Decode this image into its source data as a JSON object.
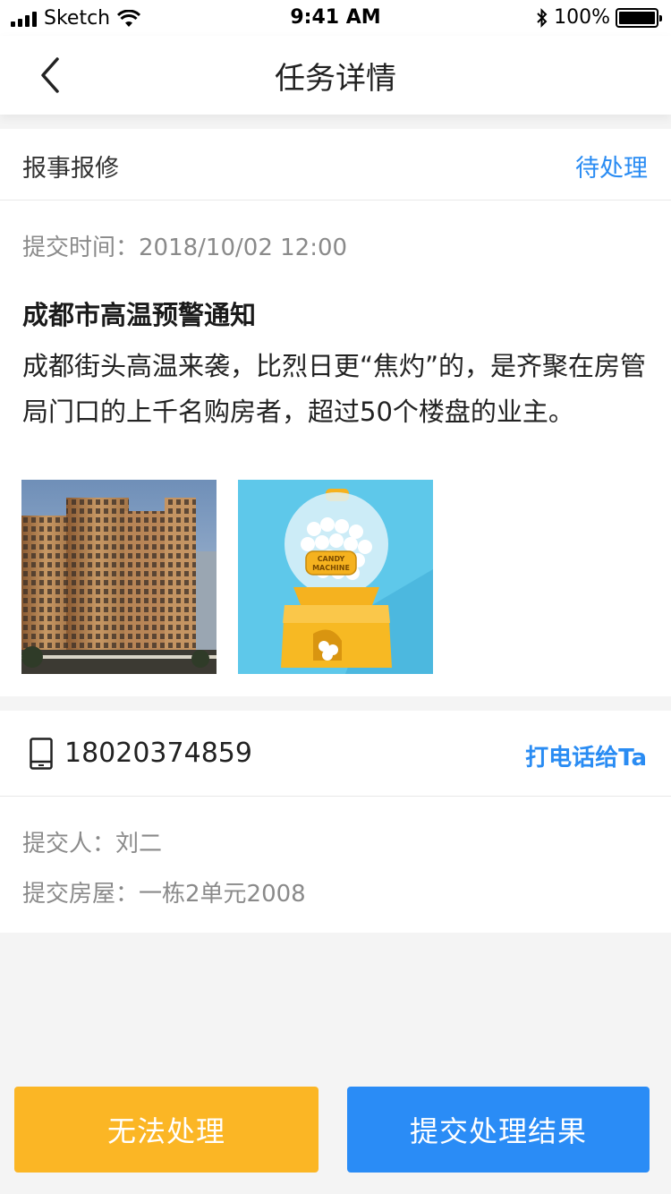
{
  "status_bar": {
    "carrier": "Sketch",
    "time": "9:41 AM",
    "battery": "100%"
  },
  "nav": {
    "title": "任务详情",
    "back_icon": "chevron-left-icon"
  },
  "task": {
    "type": "报事报修",
    "status": "待处理",
    "submit_time": "提交时间：2018/10/02 12:00",
    "title": "成都市高温预警通知",
    "body": "成都街头高温来袭，比烈日更“焦灼”的，是齐聚在房管局门口的上千名购房者，超过50个楼盘的业主。",
    "photo_text": {
      "candy_label_line1": "CANDY",
      "candy_label_line2": "MACHINE"
    }
  },
  "contact": {
    "phone_icon": "mobile-phone-icon",
    "phone": "18020374859",
    "call_label": "打电话给Ta",
    "submitter": "提交人：刘二",
    "house": "提交房屋：一栋2单元2008"
  },
  "actions": {
    "cannot_label": "无法处理",
    "submit_label": "提交处理结果"
  },
  "colors": {
    "accent": "#2a8cf3",
    "warning": "#fbb625",
    "background": "#f4f4f4"
  }
}
